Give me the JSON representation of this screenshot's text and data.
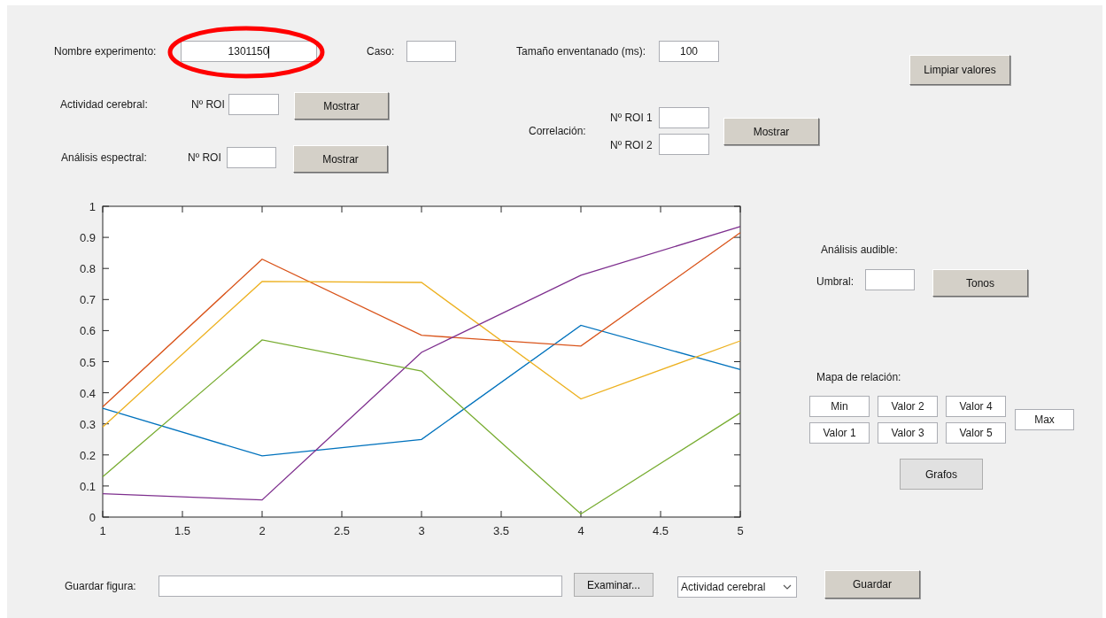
{
  "experiment": {
    "label": "Nombre experimento:",
    "value": "1301150",
    "highlighted": true
  },
  "case": {
    "label": "Caso:"
  },
  "window_size": {
    "label": "Tamaño enventanado (ms):",
    "value": "100"
  },
  "clear_button": "Limpiar valores",
  "brain_activity": {
    "label": "Actividad cerebral:",
    "roi_label": "Nº ROI",
    "button": "Mostrar"
  },
  "spectral": {
    "label": "Análisis espectral:",
    "roi_label": "Nº ROI",
    "button": "Mostrar"
  },
  "correlation": {
    "label": "Correlación:",
    "roi1_label": "Nº ROI 1",
    "roi2_label": "Nº ROI 2",
    "button": "Mostrar"
  },
  "chart": {
    "chart_data": {
      "type": "line",
      "x": [
        1,
        2,
        3,
        4,
        5
      ],
      "xlim": [
        1,
        5
      ],
      "ylim": [
        0,
        1
      ],
      "xticks": [
        1,
        1.5,
        2,
        2.5,
        3,
        3.5,
        4,
        4.5,
        5
      ],
      "yticks": [
        0,
        0.1,
        0.2,
        0.3,
        0.4,
        0.5,
        0.6,
        0.7,
        0.8,
        0.9,
        1
      ],
      "series": [
        {
          "color": "#0072bd",
          "values": [
            0.35,
            0.197,
            0.25,
            0.617,
            0.475
          ]
        },
        {
          "color": "#d95319",
          "values": [
            0.355,
            0.83,
            0.585,
            0.55,
            0.915
          ]
        },
        {
          "color": "#edb120",
          "values": [
            0.29,
            0.758,
            0.755,
            0.38,
            0.567
          ]
        },
        {
          "color": "#7e2f8e",
          "values": [
            0.075,
            0.055,
            0.53,
            0.778,
            0.935
          ]
        },
        {
          "color": "#77ac30",
          "values": [
            0.13,
            0.57,
            0.47,
            0.01,
            0.335
          ]
        }
      ]
    }
  },
  "audible": {
    "title": "Análisis audible:",
    "threshold_label": "Umbral:",
    "button": "Tonos"
  },
  "relation_map": {
    "title": "Mapa de relación:",
    "fields": [
      "Min",
      "Valor 1",
      "Valor 2",
      "Valor 3",
      "Valor 4",
      "Valor 5",
      "Max"
    ],
    "button": "Grafos"
  },
  "save": {
    "label": "Guardar figura:",
    "browse_button": "Examinar...",
    "dropdown": "Actividad cerebral",
    "button": "Guardar"
  }
}
